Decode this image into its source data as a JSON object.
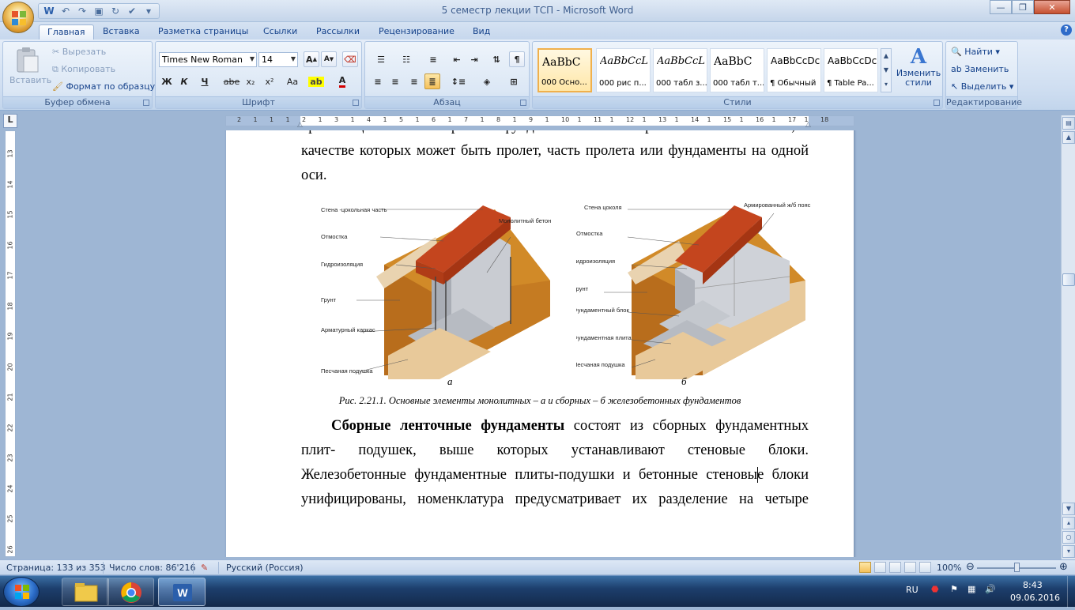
{
  "window": {
    "title": "5 семестр лекции ТСП - Microsoft Word"
  },
  "tabs": [
    "Главная",
    "Вставка",
    "Разметка страницы",
    "Ссылки",
    "Рассылки",
    "Рецензирование",
    "Вид"
  ],
  "active_tab": "Главная",
  "ribbon": {
    "clipboard": {
      "paste": "Вставить",
      "cut": "Вырезать",
      "copy": "Копировать",
      "format_painter": "Формат по образцу",
      "label": "Буфер обмена"
    },
    "font": {
      "font_name": "Times New Roman",
      "font_size": "14",
      "label": "Шрифт",
      "bold": "Ж",
      "italic": "К",
      "underline": "Ч",
      "strike": "abe",
      "subscript": "x₂",
      "superscript": "x²",
      "change_case": "Aa",
      "grow": "A",
      "shrink": "A"
    },
    "paragraph": {
      "label": "Абзац"
    },
    "styles": {
      "label": "Стили",
      "items": [
        {
          "sample": "AaBbC",
          "name": "000 Осно..."
        },
        {
          "sample": "AaBbCcL",
          "name": "000 рис п..."
        },
        {
          "sample": "AaBbCcL",
          "name": "000 табл з..."
        },
        {
          "sample": "AaBbC",
          "name": "000 табл т..."
        },
        {
          "sample": "AaBbCcDc",
          "name": "¶ Обычный"
        },
        {
          "sample": "AaBbCcDc",
          "name": "¶ Table Pa..."
        }
      ],
      "change_styles": "Изменить стили"
    },
    "editing": {
      "label": "Редактирование",
      "find": "Найти",
      "replace": "Заменить",
      "select": "Выделить"
    }
  },
  "ruler": {
    "h_numbers": [
      "2",
      "1",
      "1",
      "1",
      "2",
      "1",
      "3",
      "1",
      "4",
      "1",
      "5",
      "1",
      "6",
      "1",
      "7",
      "1",
      "8",
      "1",
      "9",
      "1",
      "10",
      "1",
      "11",
      "1",
      "12",
      "1",
      "13",
      "1",
      "14",
      "1",
      "15",
      "1",
      "16",
      "1",
      "17",
      "1",
      "18"
    ],
    "v_numbers": [
      "13",
      "14",
      "15",
      "16",
      "17",
      "18",
      "19",
      "20",
      "21",
      "22",
      "23",
      "24",
      "25",
      "26"
    ]
  },
  "document": {
    "para1": [
      "организации поточной работы фундаменты и стены разбивают на захватки, в",
      "качестве которых может быть пролет, часть пролета или фундаменты на одной",
      "оси."
    ],
    "figure_a": {
      "letter": "а",
      "labels": [
        "Стена -цокольная часть",
        "Отмостка",
        "Гидроизоляция",
        "Грунт",
        "Арматурный каркас",
        "Песчаная подушка",
        "Монолитный бетон"
      ]
    },
    "figure_b": {
      "letter": "б",
      "labels": [
        "Стена цоколя",
        "Отмостка",
        "Гидроизоляция",
        "Грунт",
        "Фундаментный блок",
        "Фундаментная плита",
        "Песчаная подушка",
        "Армированный ж/б пояс"
      ]
    },
    "caption": "Рис. 2.21.1. Основные элементы монолитных – а и сборных – б железобетонных фундаментов",
    "para2_bold": "Сборные ленточные фундаменты",
    "para2_first_rest": " состоят из сборных фундаментных",
    "para2": [
      "плит-  подушек,  выше  которых  устанавливают  стеновые  блоки.",
      "Железобетонные фундаментные плиты-подушки и бетонные стеновые блоки",
      "унифицированы, номенклатура предусматривает их разделение на четыре"
    ]
  },
  "statusbar": {
    "page": "Страница: 133 из 353",
    "words": "Число слов: 86'216",
    "language": "Русский (Россия)",
    "zoom": "100%"
  },
  "taskbar": {
    "lang": "RU",
    "time": "8:43",
    "date": "09.06.2016"
  },
  "colors": {
    "brick": "#c4451e",
    "soil": "#d18a28",
    "sand": "#e8c99a",
    "concrete": "#c9ccd2"
  }
}
